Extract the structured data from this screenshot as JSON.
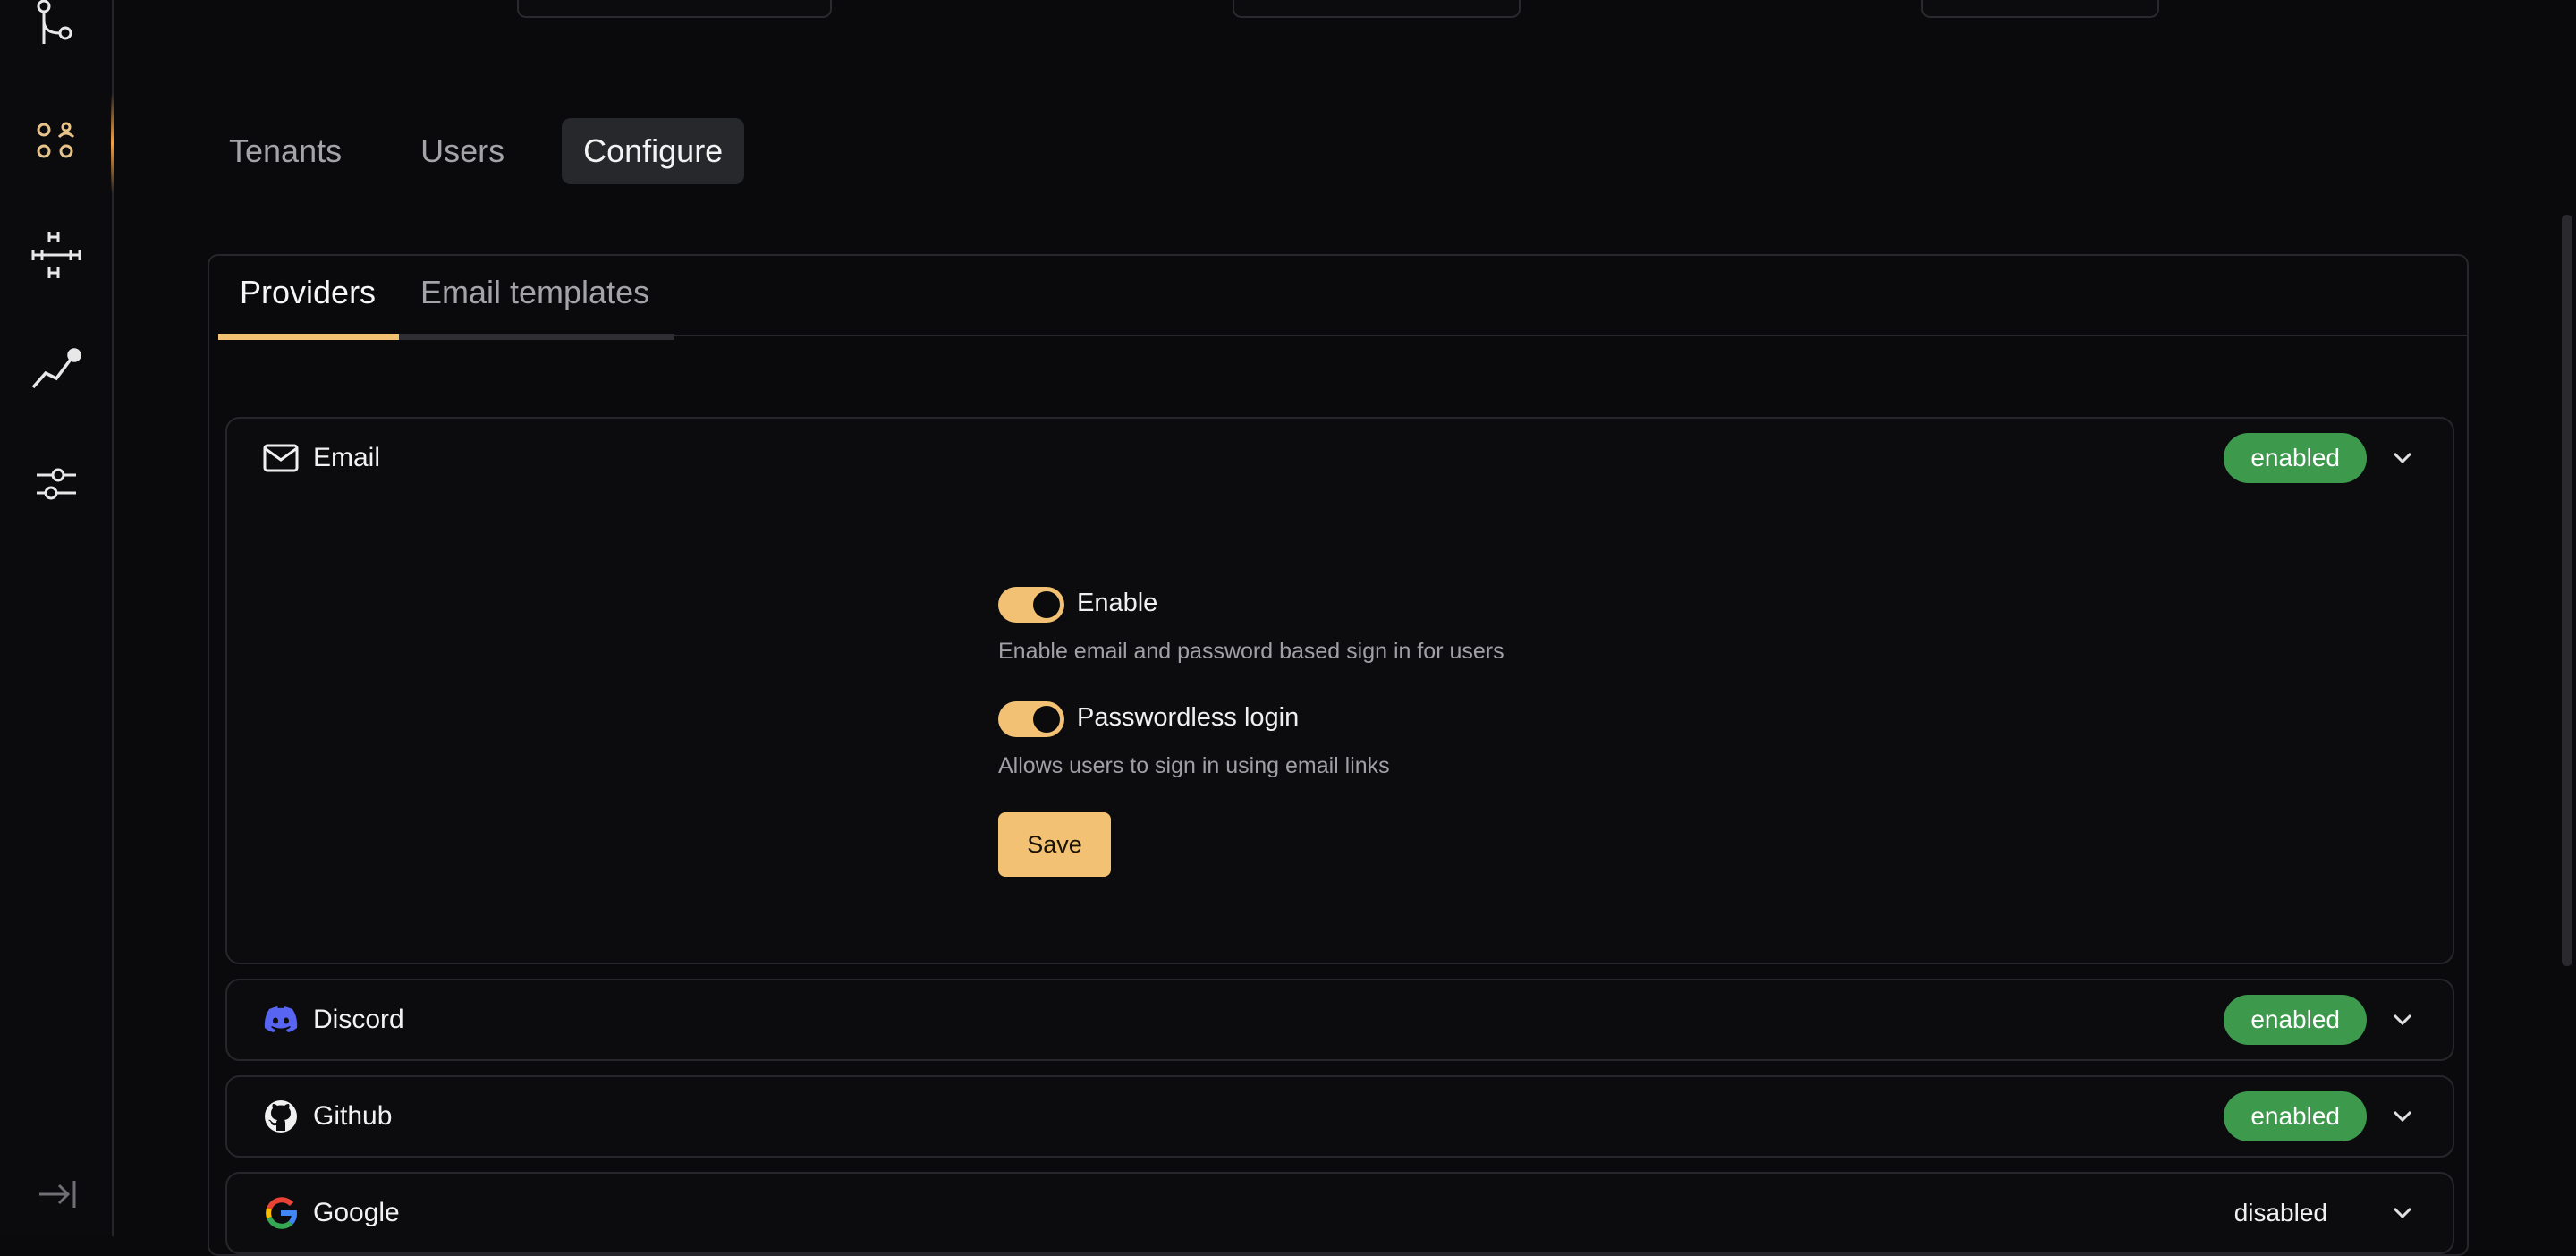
{
  "sidebar": {
    "icons": [
      "branch-icon",
      "users-groups-icon",
      "hierarchy-icon",
      "analytics-icon",
      "settings-sliders-icon"
    ],
    "active_color": "#f0a24a"
  },
  "nav": {
    "tabs": [
      {
        "label": "Tenants",
        "active": false
      },
      {
        "label": "Users",
        "active": false
      },
      {
        "label": "Configure",
        "active": true
      }
    ]
  },
  "subtabs": [
    {
      "label": "Providers",
      "active": true
    },
    {
      "label": "Email templates",
      "active": false
    }
  ],
  "providers": {
    "email": {
      "name": "Email",
      "status": "enabled",
      "enable_label": "Enable",
      "enable_help": "Enable email and password based sign in for users",
      "enable_on": true,
      "passwordless_label": "Passwordless login",
      "passwordless_help": "Allows users to sign in using email links",
      "passwordless_on": true,
      "save_label": "Save"
    },
    "discord": {
      "name": "Discord",
      "status": "enabled"
    },
    "github": {
      "name": "Github",
      "status": "enabled"
    },
    "google": {
      "name": "Google",
      "status": "disabled"
    }
  },
  "colors": {
    "accent": "#f2c173",
    "enabled_badge": "#3d9a4d",
    "discord_brand": "#5865f2"
  }
}
